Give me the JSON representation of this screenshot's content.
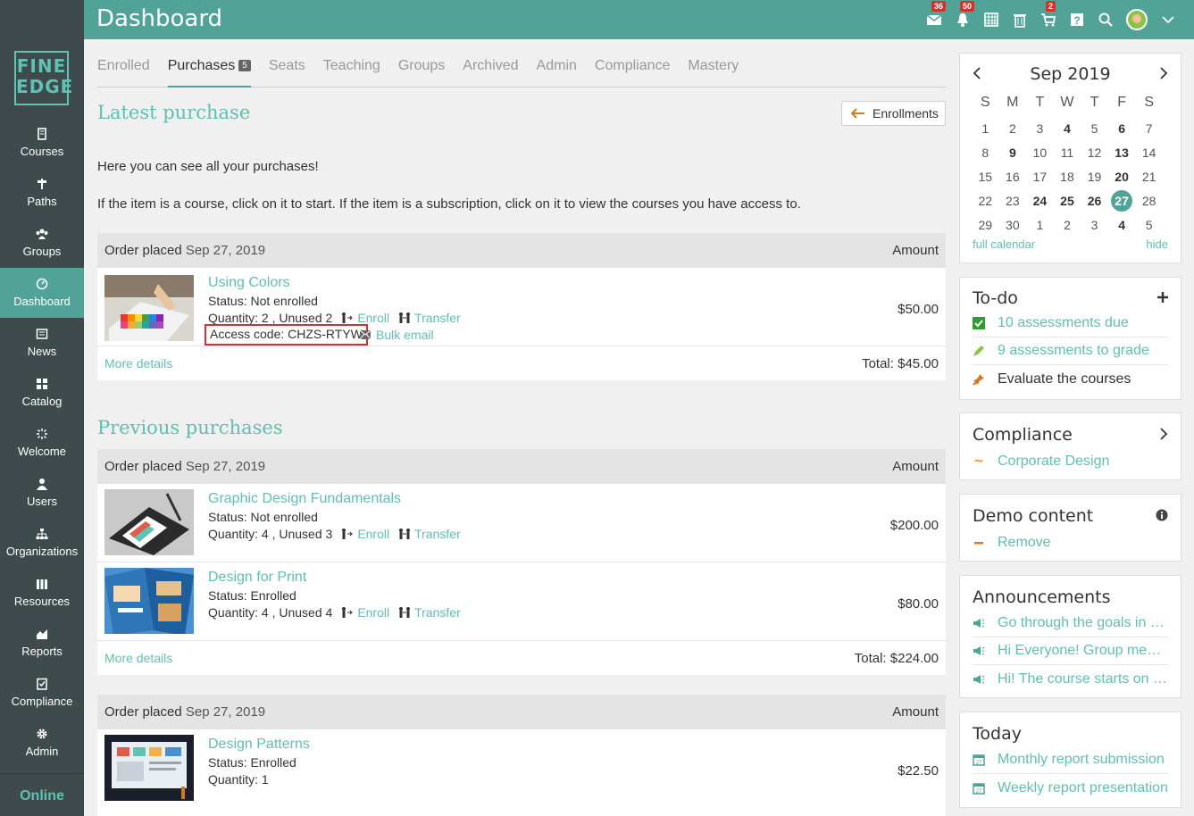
{
  "header": {
    "title": "Dashboard",
    "badges": {
      "messages": "36",
      "notifications": "50",
      "cart": "2"
    }
  },
  "logo": {
    "line1": "FINE",
    "line2": "EDGE"
  },
  "sidebar": {
    "items": [
      {
        "label": "Courses",
        "icon": "book-icon"
      },
      {
        "label": "Paths",
        "icon": "signpost-icon"
      },
      {
        "label": "Groups",
        "icon": "groups-icon"
      },
      {
        "label": "Dashboard",
        "icon": "dashboard-icon"
      },
      {
        "label": "News",
        "icon": "news-icon"
      },
      {
        "label": "Catalog",
        "icon": "catalog-icon"
      },
      {
        "label": "Welcome",
        "icon": "welcome-icon"
      },
      {
        "label": "Users",
        "icon": "user-icon"
      },
      {
        "label": "Organizations",
        "icon": "org-icon"
      },
      {
        "label": "Resources",
        "icon": "resources-icon"
      },
      {
        "label": "Reports",
        "icon": "reports-icon"
      },
      {
        "label": "Compliance",
        "icon": "compliance-icon"
      },
      {
        "label": "Admin",
        "icon": "gear-icon"
      }
    ],
    "status": "Online"
  },
  "tabs": [
    {
      "label": "Enrolled"
    },
    {
      "label": "Purchases",
      "badge": "5"
    },
    {
      "label": "Seats"
    },
    {
      "label": "Teaching"
    },
    {
      "label": "Groups"
    },
    {
      "label": "Archived"
    },
    {
      "label": "Admin"
    },
    {
      "label": "Compliance"
    },
    {
      "label": "Mastery"
    }
  ],
  "latest": {
    "heading": "Latest purchase",
    "enrollments_button": "Enrollments",
    "intro1": "Here you can see all your purchases!",
    "intro2": "If the item is a course, click on it to start. If the item is a subscription, click on it to view the courses you have access to."
  },
  "labels": {
    "order_placed": "Order placed",
    "amount": "Amount",
    "enroll": "Enroll",
    "transfer": "Transfer",
    "more_details": "More details",
    "bulk_email": "Bulk email",
    "total_label": "Total:"
  },
  "order1": {
    "date": "Sep 27, 2019",
    "item": {
      "name": "Using Colors",
      "status": "Status: Not enrolled",
      "quantity": "Quantity: 2 , Unused 2",
      "access_label": "Access code:",
      "access_code": "CHZS-RTYW",
      "price": "$50.00"
    },
    "total": "$45.00"
  },
  "previous": {
    "heading": "Previous purchases"
  },
  "order2": {
    "date": "Sep 27, 2019",
    "items": [
      {
        "name": "Graphic Design Fundamentals",
        "status": "Status: Not enrolled",
        "quantity": "Quantity: 4 , Unused 3",
        "price": "$200.00"
      },
      {
        "name": "Design for Print",
        "status": "Status: Enrolled",
        "quantity": "Quantity: 4 , Unused 4",
        "price": "$80.00"
      }
    ],
    "total": "$224.00"
  },
  "order3": {
    "date": "Sep 27, 2019",
    "item": {
      "name": "Design Patterns",
      "status": "Status: Enrolled",
      "quantity": "Quantity: 1",
      "price": "$22.50"
    }
  },
  "calendar": {
    "month": "Sep 2019",
    "weekdays": [
      "S",
      "M",
      "T",
      "W",
      "T",
      "F",
      "S"
    ],
    "weeks": [
      [
        "1",
        "2",
        "3",
        "4",
        "5",
        "6",
        "7"
      ],
      [
        "8",
        "9",
        "10",
        "11",
        "12",
        "13",
        "14"
      ],
      [
        "15",
        "16",
        "17",
        "18",
        "19",
        "20",
        "21"
      ],
      [
        "22",
        "23",
        "24",
        "25",
        "26",
        "27",
        "28"
      ],
      [
        "29",
        "30",
        "1",
        "2",
        "3",
        "4",
        "5"
      ]
    ],
    "bold_days": [
      "6",
      "9",
      "13",
      "20",
      "24",
      "25",
      "26",
      "4"
    ],
    "today": "27",
    "full_calendar": "full calendar",
    "hide": "hide"
  },
  "todo": {
    "title": "To-do",
    "items": [
      {
        "label": "10 assessments due",
        "icon": "check-icon",
        "color": "#2e9e2e"
      },
      {
        "label": "9 assessments to grade",
        "icon": "pencil-icon",
        "color": "#8bc34a"
      },
      {
        "label": "Evaluate the courses",
        "icon": "pin-icon",
        "color": "#d47a1f"
      }
    ]
  },
  "compliance": {
    "title": "Compliance",
    "items": [
      {
        "label": "Corporate Design",
        "icon": "tilde-icon"
      }
    ]
  },
  "demo": {
    "title": "Demo content",
    "items": [
      {
        "label": "Remove",
        "icon": "minus-icon"
      }
    ]
  },
  "announcements": {
    "title": "Announcements",
    "items": [
      {
        "label": "Go through the goals in the course"
      },
      {
        "label": "Hi Everyone! Group meeting"
      },
      {
        "label": "Hi! The course starts on Monday"
      }
    ]
  },
  "today": {
    "title": "Today",
    "items": [
      {
        "label": "Monthly report submission"
      },
      {
        "label": "Weekly report presentation"
      }
    ]
  },
  "colors": {
    "accent": "#52a397",
    "link": "#5fbfb0",
    "sidebar": "#3f4a4d",
    "badge": "#d9302c"
  }
}
